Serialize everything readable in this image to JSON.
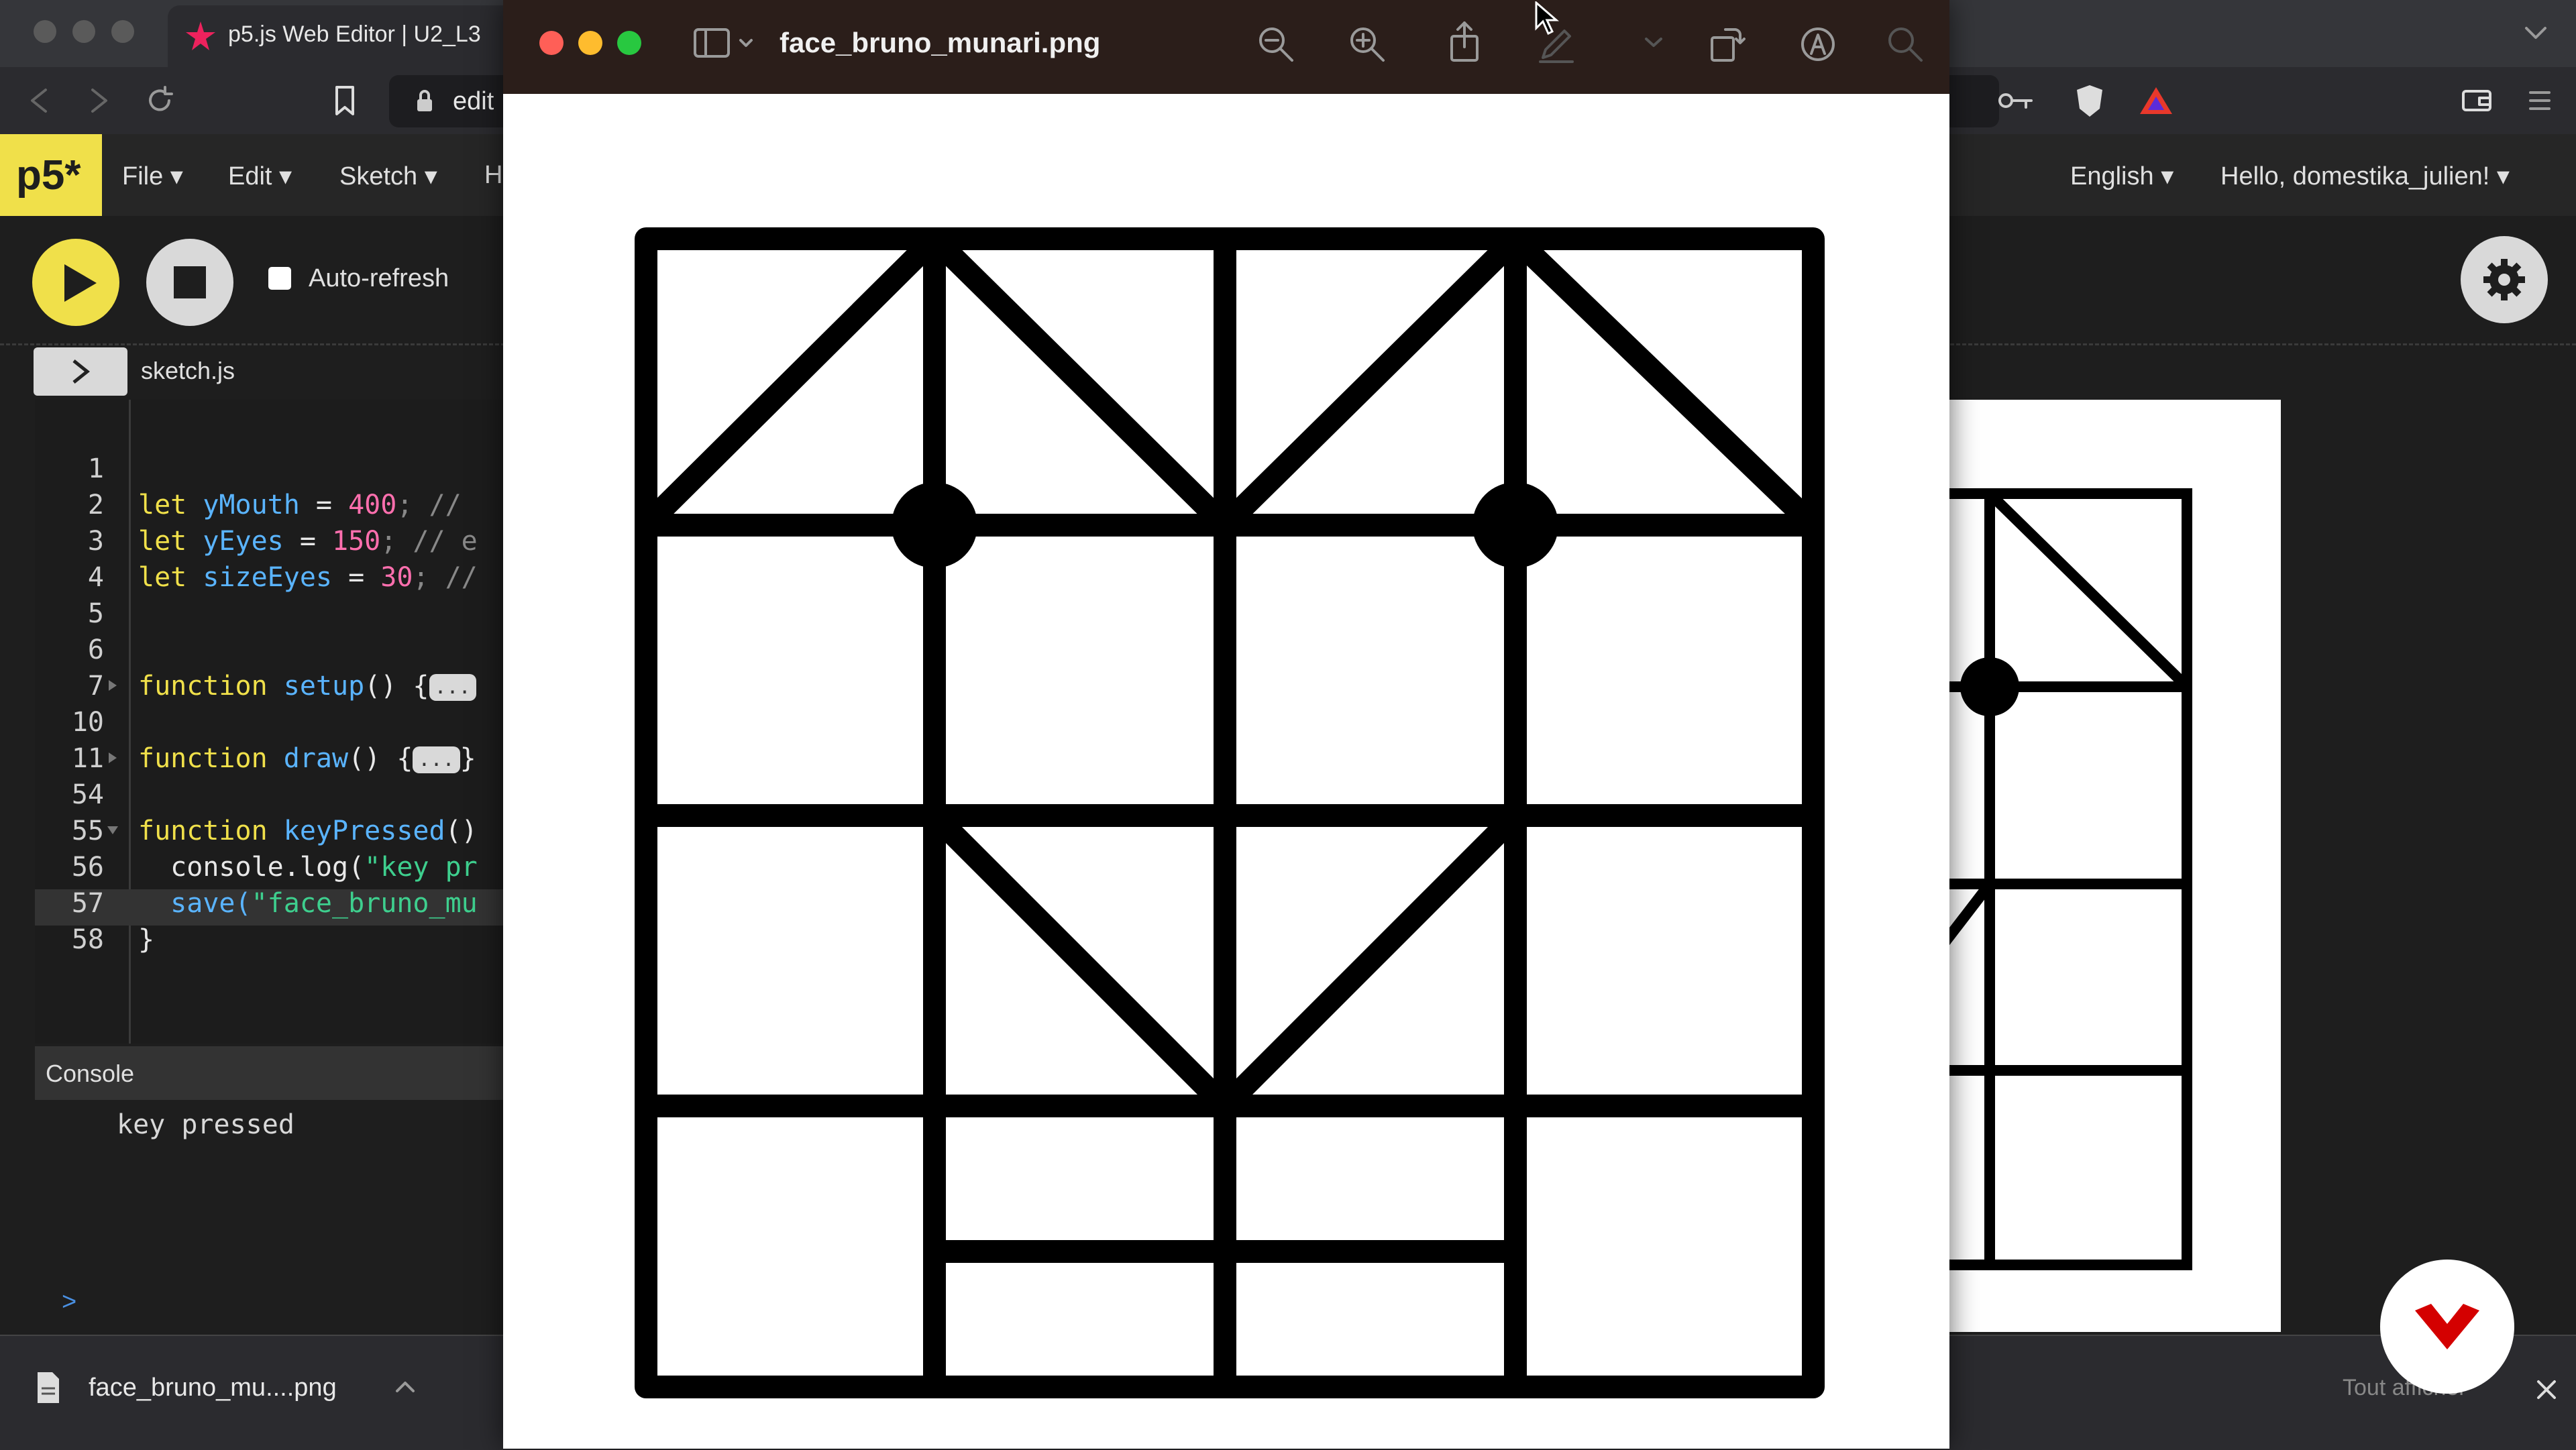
{
  "browser": {
    "tab_title": "p5.js Web Editor | U2_L3",
    "url_fragment": "edit"
  },
  "p5": {
    "logo": "p5*",
    "menu": [
      "File ▾",
      "Edit ▾",
      "Sketch ▾",
      "H"
    ],
    "language": "English ▾",
    "user": "Hello, domestika_julien! ▾",
    "auto_refresh": "Auto-refresh",
    "file_name": "sketch.js",
    "console_title": "Console",
    "console_output": "key pressed",
    "console_prompt": ">"
  },
  "code": {
    "line_numbers": [
      "1",
      "2",
      "3",
      "4",
      "5",
      "6",
      "7",
      "10",
      "11",
      "54",
      "55",
      "56",
      "57",
      "58"
    ],
    "l2": {
      "kw": "let ",
      "var": "yMouth",
      "eq": " = ",
      "num": "400",
      "rest": "; //"
    },
    "l3": {
      "kw": "let ",
      "var": "yEyes",
      "eq": " = ",
      "num": "150",
      "rest": "; // e"
    },
    "l4": {
      "kw": "let ",
      "var": "sizeEyes",
      "eq": " = ",
      "num": "30",
      "rest": "; //"
    },
    "l7": {
      "kw": "function ",
      "var": "setup",
      "rest": "() {",
      "fold": "..."
    },
    "l11": {
      "kw": "function ",
      "var": "draw",
      "rest": "() {",
      "fold": "...",
      "end": "}"
    },
    "l55": {
      "kw": "function ",
      "var": "keyPressed",
      "rest": "()"
    },
    "l56": {
      "pre": "  console.log(",
      "str": "\"key pr"
    },
    "l57": {
      "pre": "  save(",
      "str": "\"face_bruno_mu"
    },
    "l58": {
      "pre": "}"
    }
  },
  "viewer": {
    "title": "face_bruno_munari.png"
  },
  "downloads": {
    "file": "face_bruno_mu....png",
    "show_all": "Tout afficher"
  },
  "colors": {
    "p5_yellow": "#f0e04a",
    "domestika_red": "#d40000"
  }
}
